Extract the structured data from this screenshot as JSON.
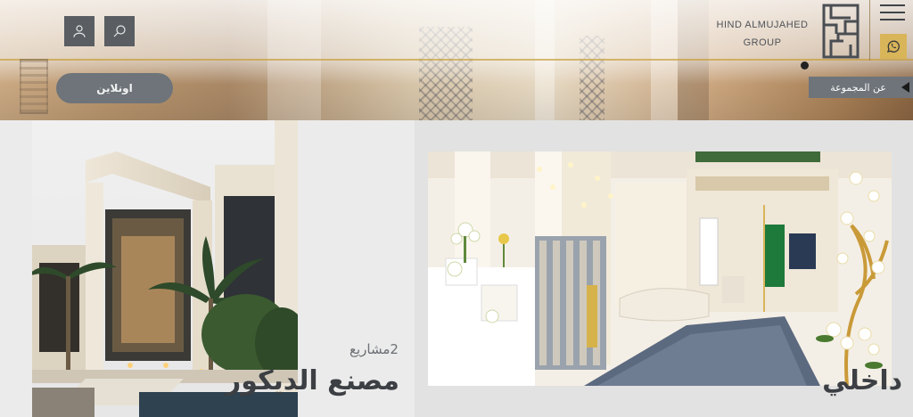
{
  "header": {
    "brand_line1": "HIND ALMUJAHED",
    "brand_line2": "GROUP",
    "online_label": "اونلاين",
    "about_label": "عن المجموعة"
  },
  "icons": {
    "search": "search-icon",
    "user": "user-icon",
    "menu": "hamburger-menu-icon",
    "whatsapp": "whatsapp-icon",
    "logo": "brand-logo",
    "arrow": "arrow-left-icon"
  },
  "colors": {
    "accent_gold": "#d9b55a",
    "button_gray": "#6e747a",
    "icon_bg": "#5a5e63",
    "heading": "#3c3f43"
  },
  "cards": {
    "left": {
      "subtitle": "2مشاريع",
      "title": "مصنع الديكور"
    },
    "right": {
      "title": "داخلي"
    }
  }
}
